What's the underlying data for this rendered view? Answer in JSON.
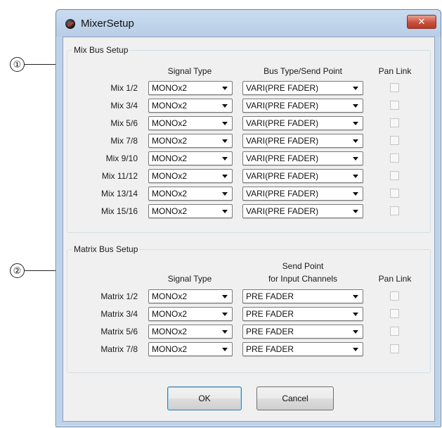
{
  "callouts": [
    "①",
    "②"
  ],
  "window": {
    "title": "MixerSetup",
    "close_glyph": "✕"
  },
  "mix_bus": {
    "group_title": "Mix Bus Setup",
    "headers": {
      "signal_type": "Signal Type",
      "bus_type": "Bus Type/Send Point",
      "pan_link": "Pan Link"
    },
    "rows": [
      {
        "label": "Mix 1/2",
        "signal_type": "MONOx2",
        "bus_type": "VARI(PRE FADER)",
        "pan_link": false
      },
      {
        "label": "Mix 3/4",
        "signal_type": "MONOx2",
        "bus_type": "VARI(PRE FADER)",
        "pan_link": false
      },
      {
        "label": "Mix 5/6",
        "signal_type": "MONOx2",
        "bus_type": "VARI(PRE FADER)",
        "pan_link": false
      },
      {
        "label": "Mix 7/8",
        "signal_type": "MONOx2",
        "bus_type": "VARI(PRE FADER)",
        "pan_link": false
      },
      {
        "label": "Mix 9/10",
        "signal_type": "MONOx2",
        "bus_type": "VARI(PRE FADER)",
        "pan_link": false
      },
      {
        "label": "Mix 11/12",
        "signal_type": "MONOx2",
        "bus_type": "VARI(PRE FADER)",
        "pan_link": false
      },
      {
        "label": "Mix 13/14",
        "signal_type": "MONOx2",
        "bus_type": "VARI(PRE FADER)",
        "pan_link": false
      },
      {
        "label": "Mix 15/16",
        "signal_type": "MONOx2",
        "bus_type": "VARI(PRE FADER)",
        "pan_link": false
      }
    ]
  },
  "matrix_bus": {
    "group_title": "Matrix Bus Setup",
    "headers": {
      "signal_type": "Signal Type",
      "send_point_line1": "Send Point",
      "send_point_line2": "for Input Channels",
      "pan_link": "Pan Link"
    },
    "rows": [
      {
        "label": "Matrix 1/2",
        "signal_type": "MONOx2",
        "send_point": "PRE FADER",
        "pan_link": false
      },
      {
        "label": "Matrix 3/4",
        "signal_type": "MONOx2",
        "send_point": "PRE FADER",
        "pan_link": false
      },
      {
        "label": "Matrix 5/6",
        "signal_type": "MONOx2",
        "send_point": "PRE FADER",
        "pan_link": false
      },
      {
        "label": "Matrix 7/8",
        "signal_type": "MONOx2",
        "send_point": "PRE FADER",
        "pan_link": false
      }
    ]
  },
  "buttons": {
    "ok": "OK",
    "cancel": "Cancel"
  }
}
